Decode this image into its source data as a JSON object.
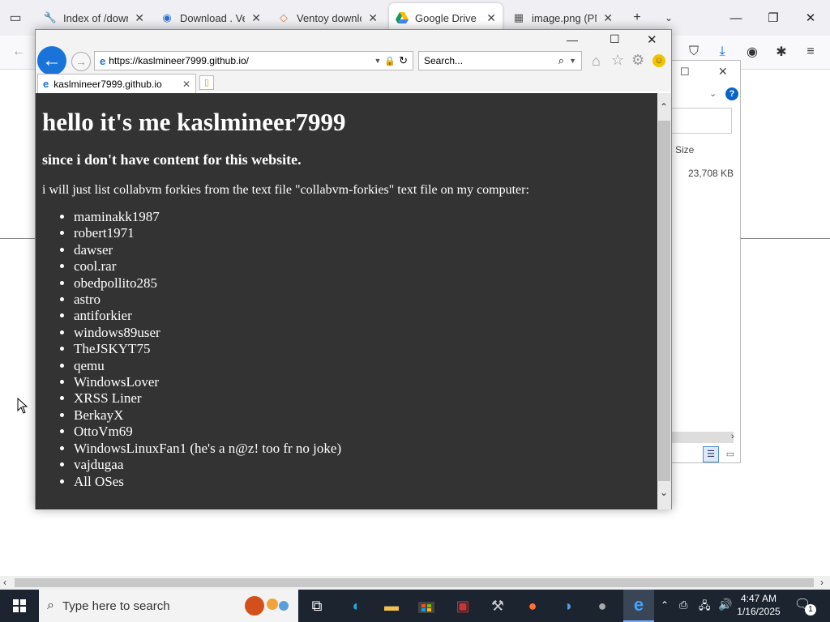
{
  "firefox": {
    "tabs": [
      {
        "label": "Index of /downlo",
        "icon": "wrench-icon"
      },
      {
        "label": "Download . Vent",
        "icon": "globe-icon"
      },
      {
        "label": "Ventoy downloa",
        "icon": "ventoy-icon"
      },
      {
        "label": "Google Drive - V",
        "icon": "drive-icon",
        "active": true
      },
      {
        "label": "image.png (PNG",
        "icon": "image-icon"
      }
    ]
  },
  "explorer": {
    "size_header": "Size",
    "size_value": "23,708 KB"
  },
  "ie": {
    "url": "https://kaslmineer7999.github.io/",
    "search_placeholder": "Search...",
    "tab_title": "kaslmineer7999.github.io"
  },
  "page": {
    "heading": "hello it's me kaslmineer7999",
    "subheading": "since i don't have content for this website.",
    "intro": "i will just list collabvm forkies from the text file \"collabvm-forkies\" text file on my computer:",
    "forkies": [
      "maminakk1987",
      "robert1971",
      "dawser",
      "cool.rar",
      "obedpollito285",
      "astro",
      "antiforkier",
      "windows89user",
      "TheJSKYT75",
      "qemu",
      "WindowsLover",
      "XRSS Liner",
      "BerkayX",
      "OttoVm69",
      "WindowsLinuxFan1 (he's a n@z! too fr no joke)",
      "vajdugaa",
      "All OSes"
    ]
  },
  "taskbar": {
    "search_placeholder": "Type here to search",
    "time": "4:47 AM",
    "date": "1/16/2025",
    "notification_count": "1"
  }
}
